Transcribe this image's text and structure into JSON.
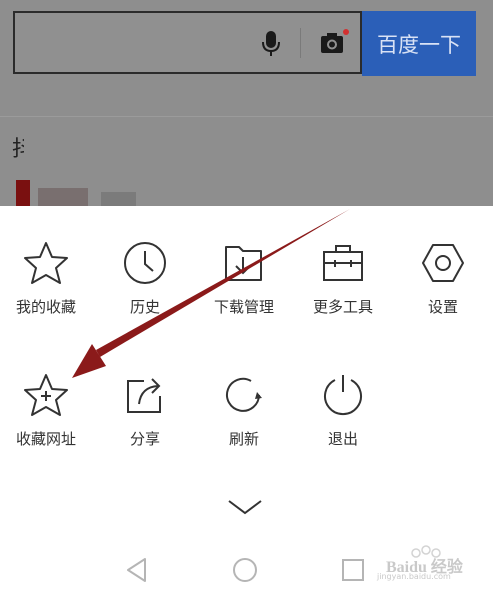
{
  "search": {
    "button_label": "百度一下"
  },
  "background": {
    "fragment_1": "抖"
  },
  "menu": {
    "row1": [
      {
        "label": "我的收藏",
        "icon": "star-icon"
      },
      {
        "label": "历史",
        "icon": "clock-icon"
      },
      {
        "label": "下载管理",
        "icon": "download-folder-icon"
      },
      {
        "label": "更多工具",
        "icon": "toolbox-icon"
      },
      {
        "label": "设置",
        "icon": "hexagon-settings-icon"
      }
    ],
    "row2": [
      {
        "label": "收藏网址",
        "icon": "star-plus-icon"
      },
      {
        "label": "分享",
        "icon": "share-icon"
      },
      {
        "label": "刷新",
        "icon": "refresh-icon"
      },
      {
        "label": "退出",
        "icon": "power-icon"
      }
    ]
  },
  "watermark": {
    "brand": "Baidu 经验",
    "sub": "jingyan.baidu.com"
  },
  "colors": {
    "search_button": "#2b5fb8",
    "arrow": "#8b1a1a",
    "icon_stroke": "#333333"
  }
}
